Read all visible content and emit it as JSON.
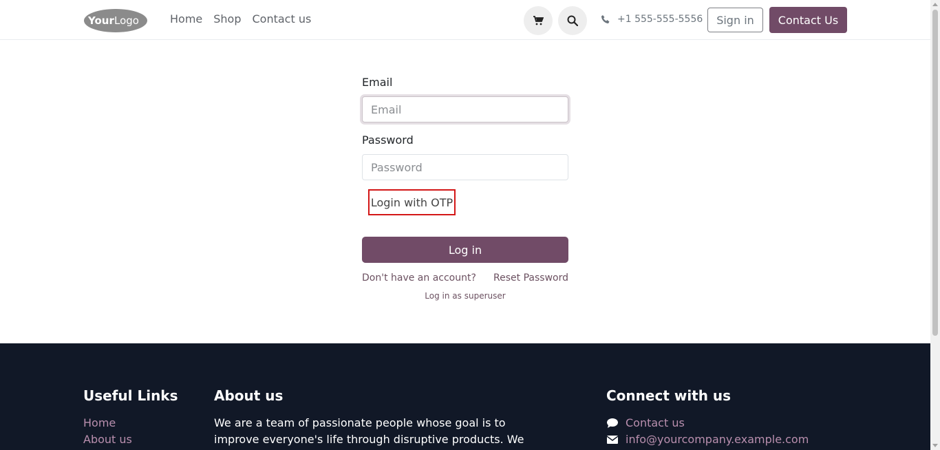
{
  "header": {
    "logo_text": "YourLogo",
    "nav": [
      "Home",
      "Shop",
      "Contact us"
    ],
    "phone": "+1 555-555-5556",
    "signin_label": "Sign in",
    "contact_label": "Contact Us",
    "icons": {
      "cart": "cart-icon",
      "search": "search-icon",
      "phone": "phone-icon"
    }
  },
  "login": {
    "email_label": "Email",
    "email_placeholder": "Email",
    "email_value": "",
    "password_label": "Password",
    "password_placeholder": "Password",
    "password_value": "",
    "otp_label": "Login with OTP",
    "login_button": "Log in",
    "no_account": "Don't have an account?",
    "reset_password": "Reset Password",
    "superuser": "Log in as superuser"
  },
  "footer": {
    "useful_links_title": "Useful Links",
    "useful_links": [
      "Home",
      "About us"
    ],
    "about_title": "About us",
    "about_text": "We are a team of passionate people whose goal is to improve everyone's life through disruptive products. We build great",
    "connect_title": "Connect with us",
    "connect_contact": "Contact us",
    "connect_email": "info@yourcompany.example.com"
  },
  "colors": {
    "accent": "#714b67",
    "footer_bg": "#111827",
    "link_on_dark": "#b98fae",
    "highlight": "#d31616"
  }
}
